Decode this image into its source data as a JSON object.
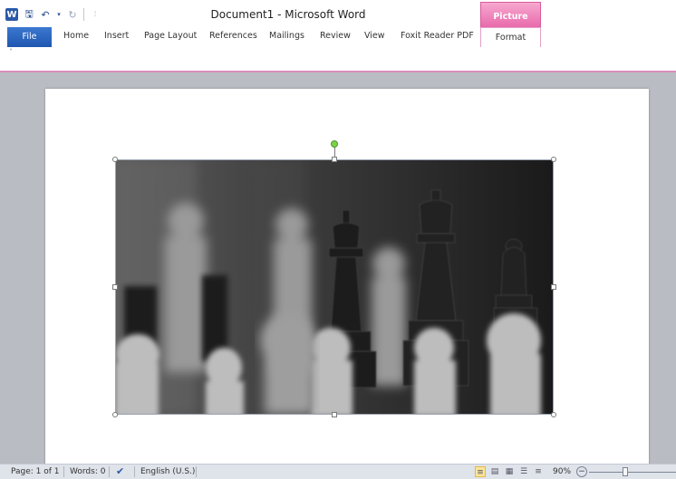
{
  "window": {
    "title": "Document1 - Microsoft Word"
  },
  "qat": {
    "logo": "W",
    "save_icon": "save-icon",
    "undo_icon": "undo-icon",
    "redo_icon": "redo-icon",
    "customize_icon": "customize-icon"
  },
  "contextual": {
    "label": "Picture Tools",
    "color": "#e86aab"
  },
  "tabs": {
    "file": "File",
    "items": [
      "Home",
      "Insert",
      "Page Layout",
      "References",
      "Mailings",
      "Review",
      "View",
      "Foxit Reader PDF"
    ],
    "format": "Format"
  },
  "status": {
    "page": "Page: 1 of 1",
    "words": "Words: 0",
    "language": "English (U.S.)",
    "zoom": "90%",
    "zoom_fraction": 0.9
  },
  "image": {
    "subject": "chess-pieces-photo"
  }
}
